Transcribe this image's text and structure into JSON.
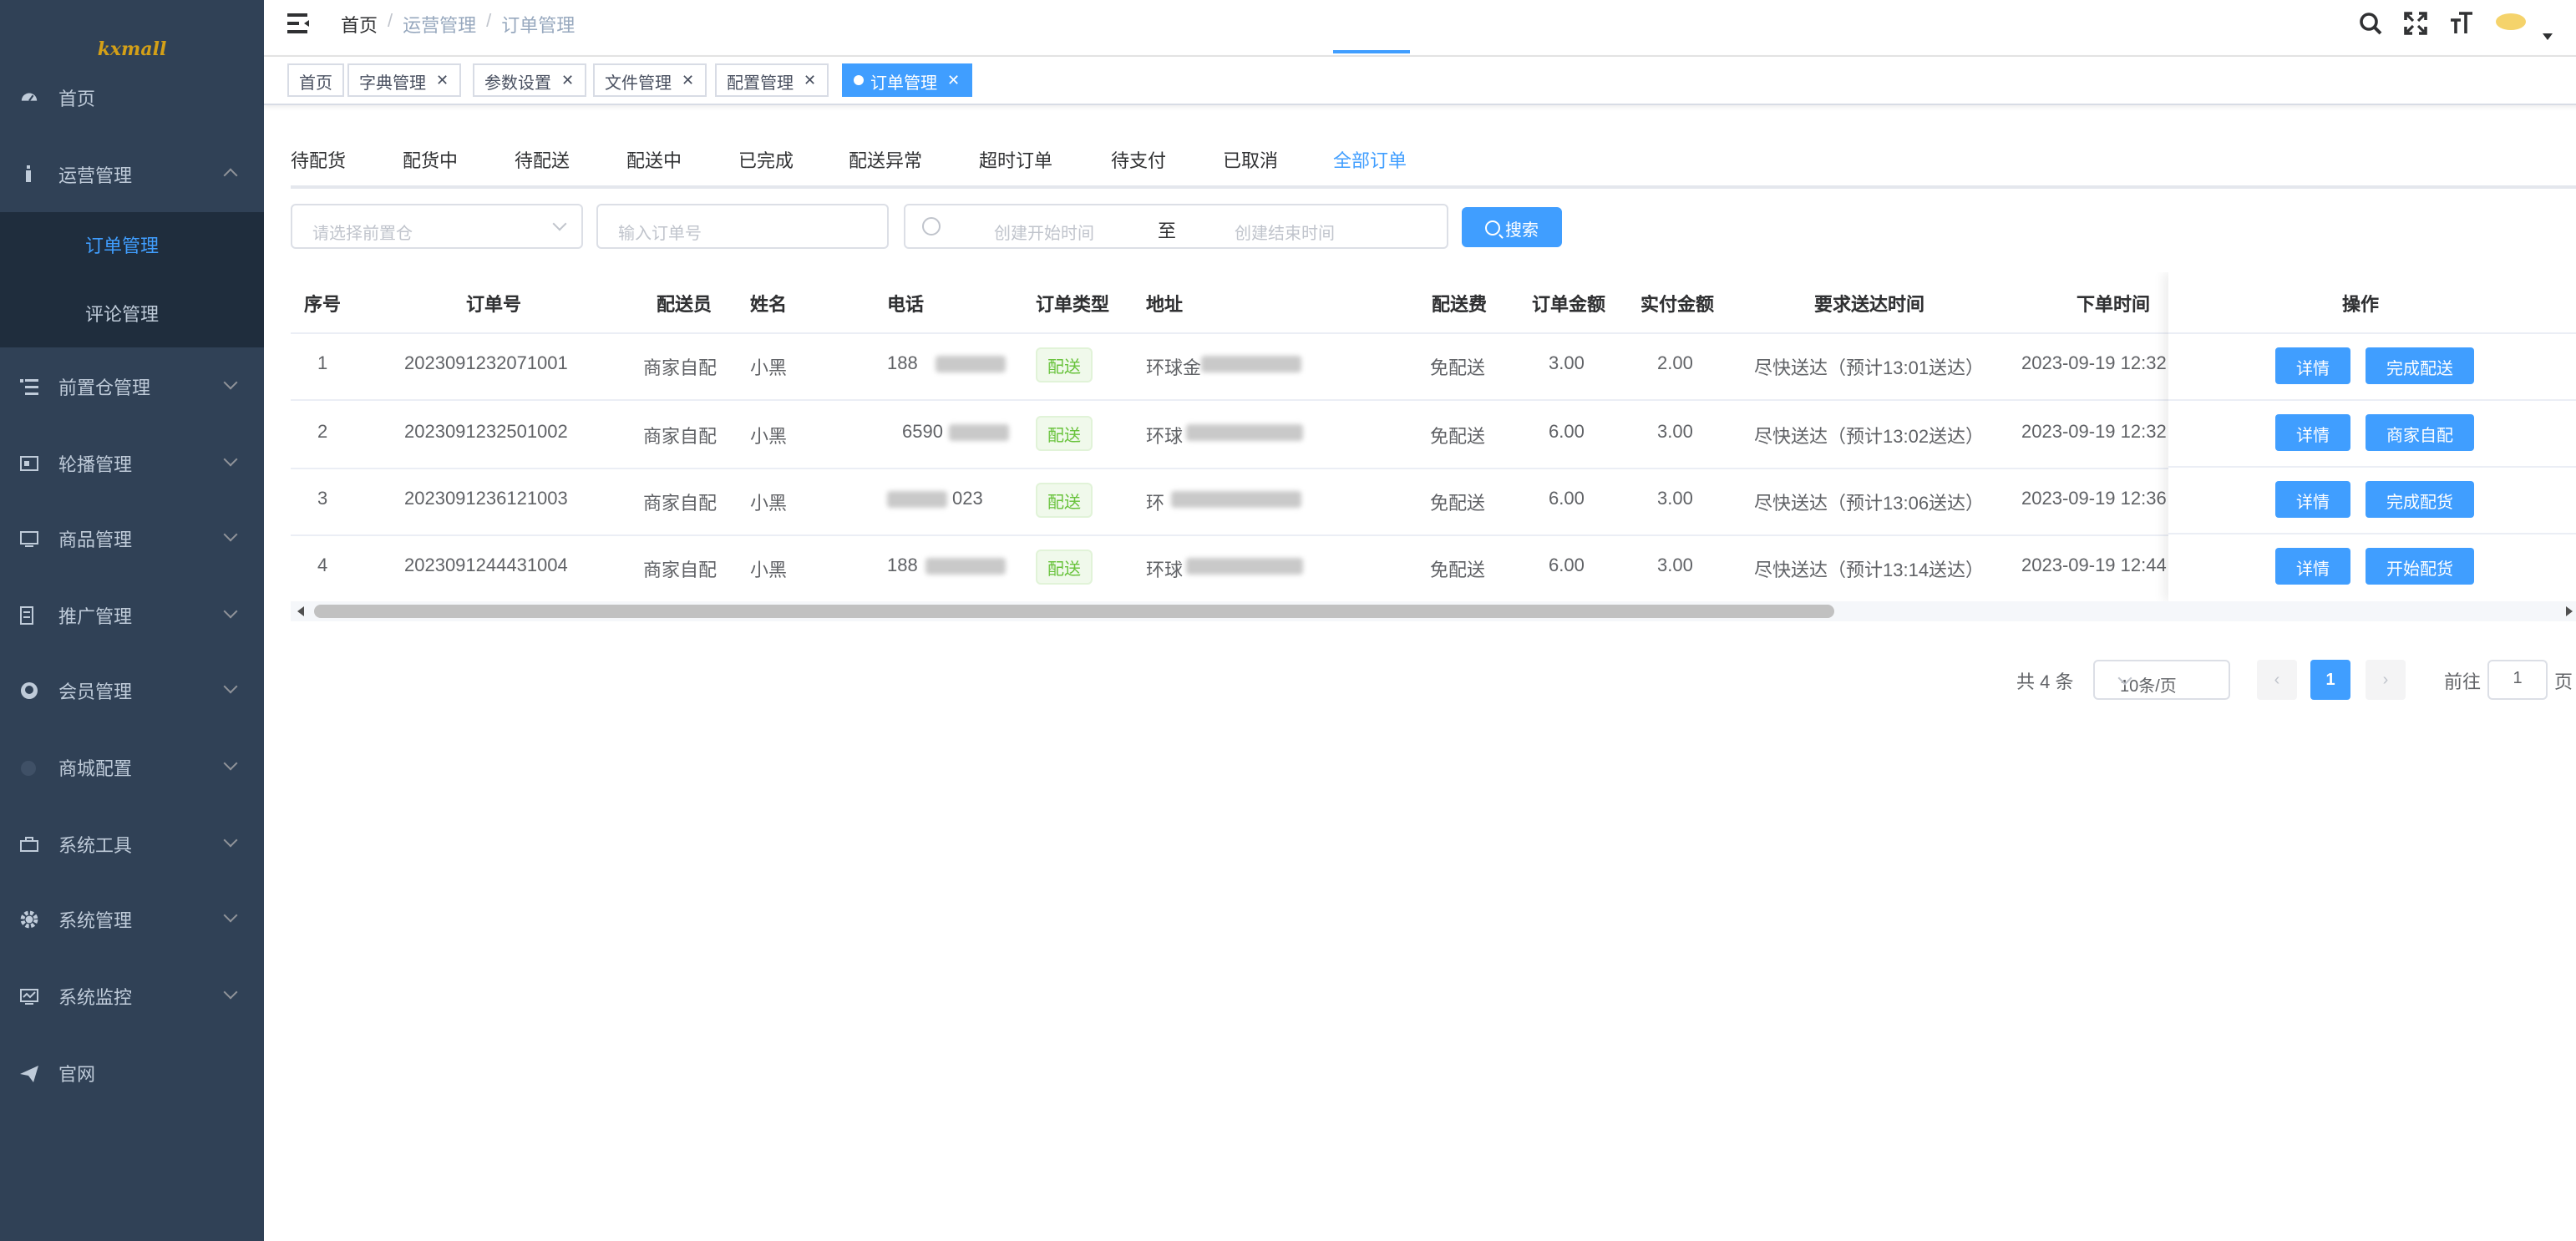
{
  "app": {
    "logo": "kxmall"
  },
  "sidebar": {
    "items": [
      {
        "label": "首页",
        "icon": "dashboard-icon"
      },
      {
        "label": "运营管理",
        "icon": "operation-icon"
      },
      {
        "label": "前置仓管理",
        "icon": "list-icon"
      },
      {
        "label": "轮播管理",
        "icon": "banner-icon"
      },
      {
        "label": "商品管理",
        "icon": "monitor-icon"
      },
      {
        "label": "推广管理",
        "icon": "promo-icon"
      },
      {
        "label": "会员管理",
        "icon": "github-icon"
      },
      {
        "label": "商城配置",
        "icon": "dot-icon"
      },
      {
        "label": "系统工具",
        "icon": "tool-icon"
      },
      {
        "label": "系统管理",
        "icon": "gear-icon"
      },
      {
        "label": "系统监控",
        "icon": "monitor-icon"
      },
      {
        "label": "官网",
        "icon": "send-icon"
      }
    ],
    "sub_items": [
      {
        "label": "订单管理",
        "active": true
      },
      {
        "label": "评论管理",
        "active": false
      }
    ]
  },
  "header": {
    "breadcrumb": [
      "首页",
      "运营管理",
      "订单管理"
    ],
    "icons": [
      "search-icon",
      "fullscreen-icon",
      "font-size-icon",
      "avatar"
    ]
  },
  "tags": [
    {
      "label": "首页",
      "closable": false,
      "active": false
    },
    {
      "label": "字典管理",
      "closable": true,
      "active": false
    },
    {
      "label": "参数设置",
      "closable": true,
      "active": false
    },
    {
      "label": "文件管理",
      "closable": true,
      "active": false
    },
    {
      "label": "配置管理",
      "closable": true,
      "active": false
    },
    {
      "label": "订单管理",
      "closable": true,
      "active": true
    }
  ],
  "tabs": [
    "待配货",
    "配货中",
    "待配送",
    "配送中",
    "已完成",
    "配送异常",
    "超时订单",
    "待支付",
    "已取消",
    "全部订单"
  ],
  "filters": {
    "warehouse_placeholder": "请选择前置仓",
    "order_no_placeholder": "输入订单号",
    "start_placeholder": "创建开始时间",
    "range_separator": "至",
    "end_placeholder": "创建结束时间",
    "search_label": "搜索"
  },
  "table": {
    "columns": [
      "序号",
      "订单号",
      "配送员",
      "姓名",
      "电话",
      "订单类型",
      "地址",
      "配送费",
      "订单金额",
      "实付金额",
      "要求送达时间",
      "下单时间",
      "操作"
    ],
    "rows": [
      {
        "idx": "1",
        "order_no": "2023091232071001",
        "courier": "商家自配",
        "name": "小黑",
        "phone": "188",
        "type": "配送",
        "address": "环球金",
        "fee": "免配送",
        "amount": "3.00",
        "paid": "2.00",
        "deliver": "尽快送达（预计13:01送达）",
        "created": "2023-09-19 12:32",
        "detail": "详情",
        "action": "完成配送"
      },
      {
        "idx": "2",
        "order_no": "2023091232501002",
        "courier": "商家自配",
        "name": "小黑",
        "phone": "6590",
        "type": "配送",
        "address": "环球",
        "fee": "免配送",
        "amount": "6.00",
        "paid": "3.00",
        "deliver": "尽快送达（预计13:02送达）",
        "created": "2023-09-19 12:32",
        "detail": "详情",
        "action": "商家自配"
      },
      {
        "idx": "3",
        "order_no": "2023091236121003",
        "courier": "商家自配",
        "name": "小黑",
        "phone": "023",
        "type": "配送",
        "address": "环",
        "fee": "免配送",
        "amount": "6.00",
        "paid": "3.00",
        "deliver": "尽快送达（预计13:06送达）",
        "created": "2023-09-19 12:36",
        "detail": "详情",
        "action": "完成配货"
      },
      {
        "idx": "4",
        "order_no": "2023091244431004",
        "courier": "商家自配",
        "name": "小黑",
        "phone": "188",
        "type": "配送",
        "address": "环球",
        "fee": "免配送",
        "amount": "6.00",
        "paid": "3.00",
        "deliver": "尽快送达（预计13:14送达）",
        "created": "2023-09-19 12:44",
        "detail": "详情",
        "action": "开始配货"
      }
    ]
  },
  "pagination": {
    "total": "共 4 条",
    "page_size": "10条/页",
    "current": "1",
    "goto_prefix": "前往",
    "goto_value": "1",
    "goto_suffix": "页"
  },
  "colors": {
    "primary": "#409eff",
    "sidebar_bg": "#304156",
    "sidebar_active_bg": "#1f2d3d",
    "success": "#67c23a"
  }
}
